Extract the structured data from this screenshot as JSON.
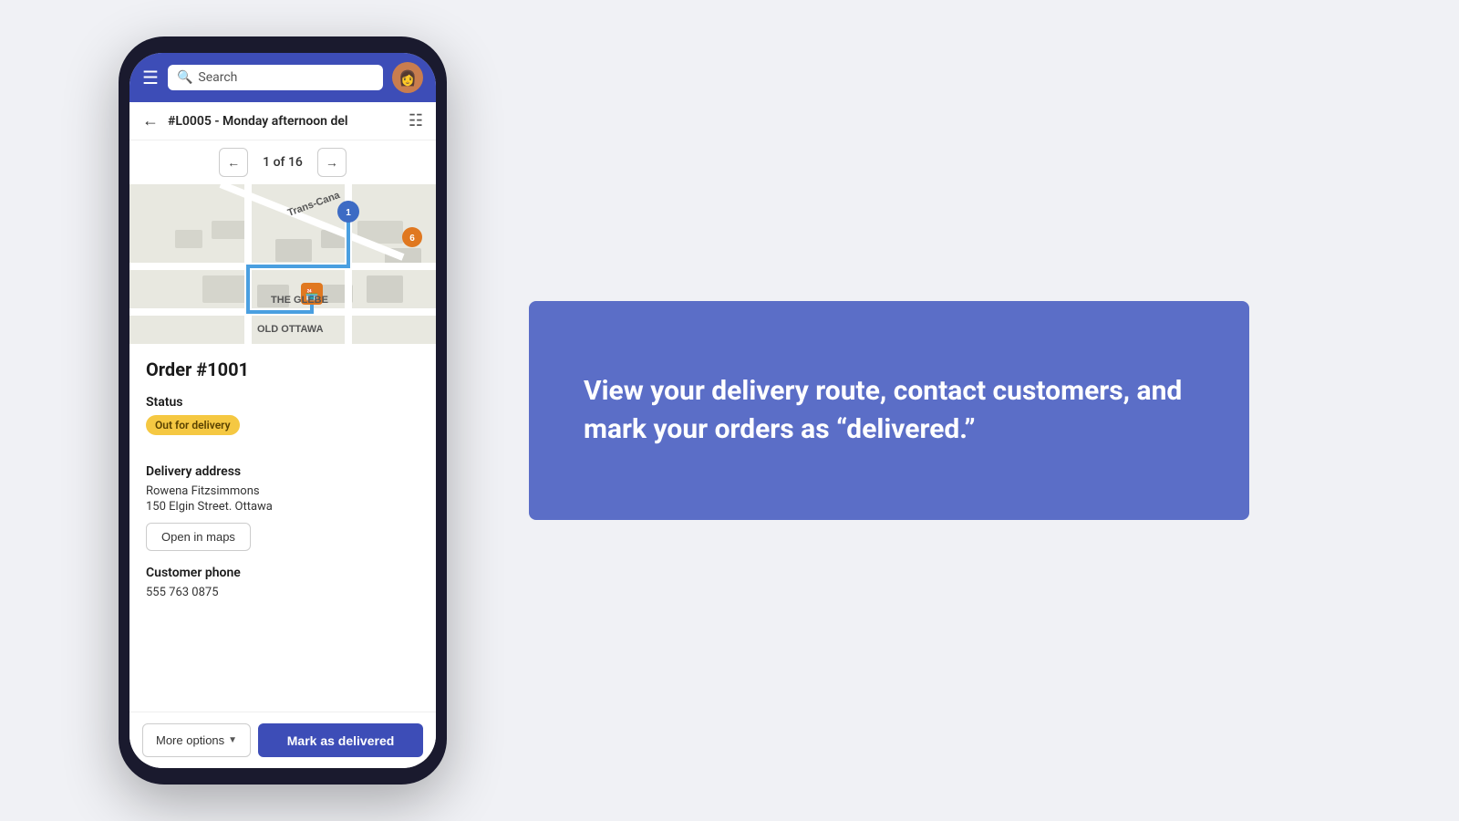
{
  "phone": {
    "nav": {
      "search_placeholder": "Search",
      "avatar_emoji": "👩"
    },
    "route_header": {
      "title": "#L0005 - Monday afternoon del",
      "back_label": "←",
      "list_icon": "≡"
    },
    "pagination": {
      "current": 1,
      "total": 16,
      "display": "1 of 16"
    },
    "order": {
      "number": "Order #1001",
      "status_label": "Status",
      "status_value": "Out for delivery",
      "delivery_address_label": "Delivery address",
      "customer_name": "Rowena Fitzsimmons",
      "address_line": "150 Elgin Street. Ottawa",
      "open_maps_label": "Open in maps",
      "customer_phone_label": "Customer phone",
      "phone_number": "555 763 0875"
    },
    "actions": {
      "more_options": "More options",
      "mark_delivered": "Mark as delivered"
    }
  },
  "info_panel": {
    "text": "View your delivery route, contact customers, and mark your orders as “delivered.”"
  },
  "map": {
    "area_label": "THE GLEBE",
    "sub_label": "OLD OTTAWA",
    "route_label": "Trans-Cana"
  }
}
